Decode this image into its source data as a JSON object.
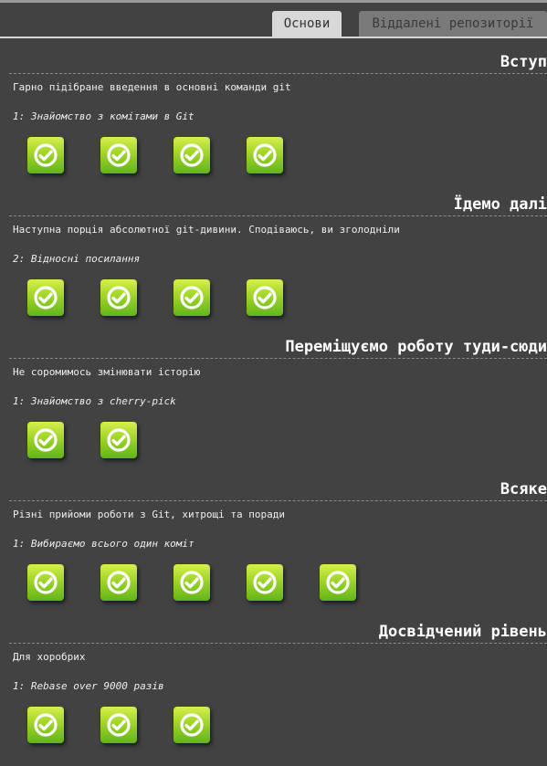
{
  "tabs": [
    {
      "label": "Основи",
      "active": true
    },
    {
      "label": "Віддалені репозиторії",
      "active": false
    }
  ],
  "sections": [
    {
      "title": "Вступ",
      "description": "Гарно підібране введення в основні команди git",
      "current_level": "1: Знайомство з комітами в Git",
      "levels_completed": 4
    },
    {
      "title": "Їдемо далі",
      "description": "Наступна порція абсолютної git-дивини. Сподіваюсь, ви зголодніли",
      "current_level": "2: Відносні посилання",
      "levels_completed": 4
    },
    {
      "title": "Переміщуємо роботу туди-сюди",
      "description": "Не соромимось змінювати історію",
      "current_level": "1: Знайомство з cherry-pick",
      "levels_completed": 2
    },
    {
      "title": "Всяке",
      "description": "Різні прийоми роботи з Git, хитрощі та поради",
      "current_level": "1: Вибираємо всього один коміт",
      "levels_completed": 5
    },
    {
      "title": "Досвідчений рівень",
      "description": "Для хоробрих",
      "current_level": "1: Rebase over 9000 разів",
      "levels_completed": 3
    }
  ],
  "icons": {
    "level_done": "checkmark-circle-icon"
  },
  "colors": {
    "background": "#424242",
    "level_green": "#9fd529",
    "tab_active": "#d8d8d8",
    "tab_inactive": "#7a7a7a"
  }
}
